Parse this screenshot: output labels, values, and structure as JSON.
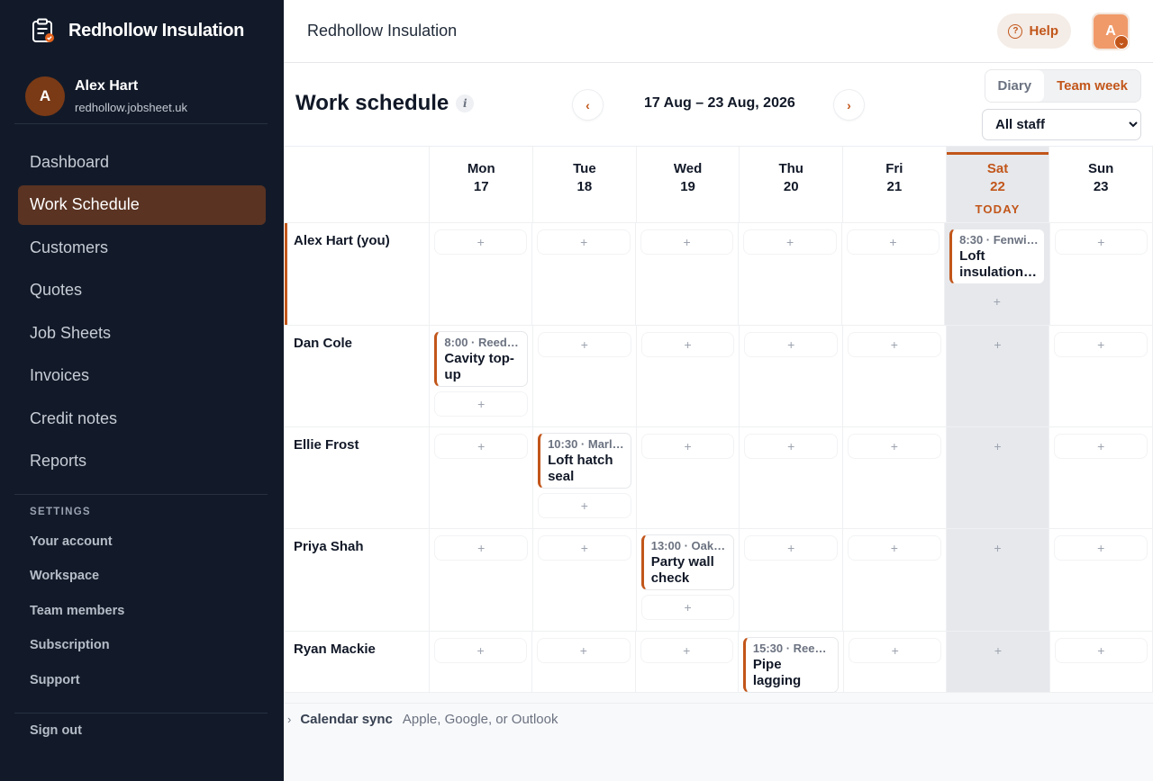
{
  "brand": {
    "name": "Redhollow Insulation"
  },
  "user": {
    "initial": "A",
    "name": "Alex Hart",
    "org": "redhollow.jobsheet.uk"
  },
  "nav": [
    {
      "label": "Dashboard",
      "active": false
    },
    {
      "label": "Work Schedule",
      "active": true
    },
    {
      "label": "Customers",
      "active": false
    },
    {
      "label": "Quotes",
      "active": false
    },
    {
      "label": "Job Sheets",
      "active": false
    },
    {
      "label": "Invoices",
      "active": false
    },
    {
      "label": "Credit notes",
      "active": false
    },
    {
      "label": "Reports",
      "active": false
    }
  ],
  "settings": {
    "title": "SETTINGS",
    "items": [
      "Your account",
      "Workspace",
      "Team members",
      "Subscription",
      "Support"
    ]
  },
  "signout": "Sign out",
  "topbar": {
    "title": "Redhollow Insulation",
    "help": "Help",
    "avatar_initial": "A"
  },
  "schedule": {
    "title": "Work schedule",
    "info_icon": "i",
    "prev": "‹",
    "next": "›",
    "range": "17 Aug – 23 Aug, 2026",
    "views": [
      "Diary",
      "Team week"
    ],
    "active_view": "Team week",
    "staff_filter": "All staff",
    "add_glyph": "+",
    "days": [
      {
        "dow": "Mon",
        "date": "17",
        "today": false
      },
      {
        "dow": "Tue",
        "date": "18",
        "today": false
      },
      {
        "dow": "Wed",
        "date": "19",
        "today": false
      },
      {
        "dow": "Thu",
        "date": "20",
        "today": false
      },
      {
        "dow": "Fri",
        "date": "21",
        "today": false
      },
      {
        "dow": "Sat",
        "date": "22",
        "today": true
      },
      {
        "dow": "Sun",
        "date": "23",
        "today": false
      }
    ],
    "today_label": "TODAY",
    "staff": [
      {
        "name": "Alex Hart (you)",
        "active": true,
        "jobs": [
          {
            "day": 5,
            "meta": "8:30 · Fenwi…",
            "title": "Loft insulation…"
          }
        ]
      },
      {
        "name": "Dan Cole",
        "active": false,
        "jobs": [
          {
            "day": 0,
            "meta": "8:00 · Reed…",
            "title": "Cavity top-up"
          }
        ]
      },
      {
        "name": "Ellie Frost",
        "active": false,
        "jobs": [
          {
            "day": 1,
            "meta": "10:30 · Marl…",
            "title": "Loft hatch seal"
          }
        ]
      },
      {
        "name": "Priya Shah",
        "active": false,
        "jobs": [
          {
            "day": 2,
            "meta": "13:00 · Oak…",
            "title": "Party wall check"
          }
        ]
      },
      {
        "name": "Ryan Mackie",
        "active": false,
        "jobs": [
          {
            "day": 3,
            "meta": "15:30 · Reed…",
            "title": "Pipe lagging"
          }
        ]
      }
    ]
  },
  "calendar_sync": {
    "label": "Calendar sync",
    "desc": "Apple, Google, or Outlook"
  },
  "colors": {
    "accent": "#c2561a",
    "sidebar": "#121a29",
    "active_nav": "#5a3322"
  }
}
